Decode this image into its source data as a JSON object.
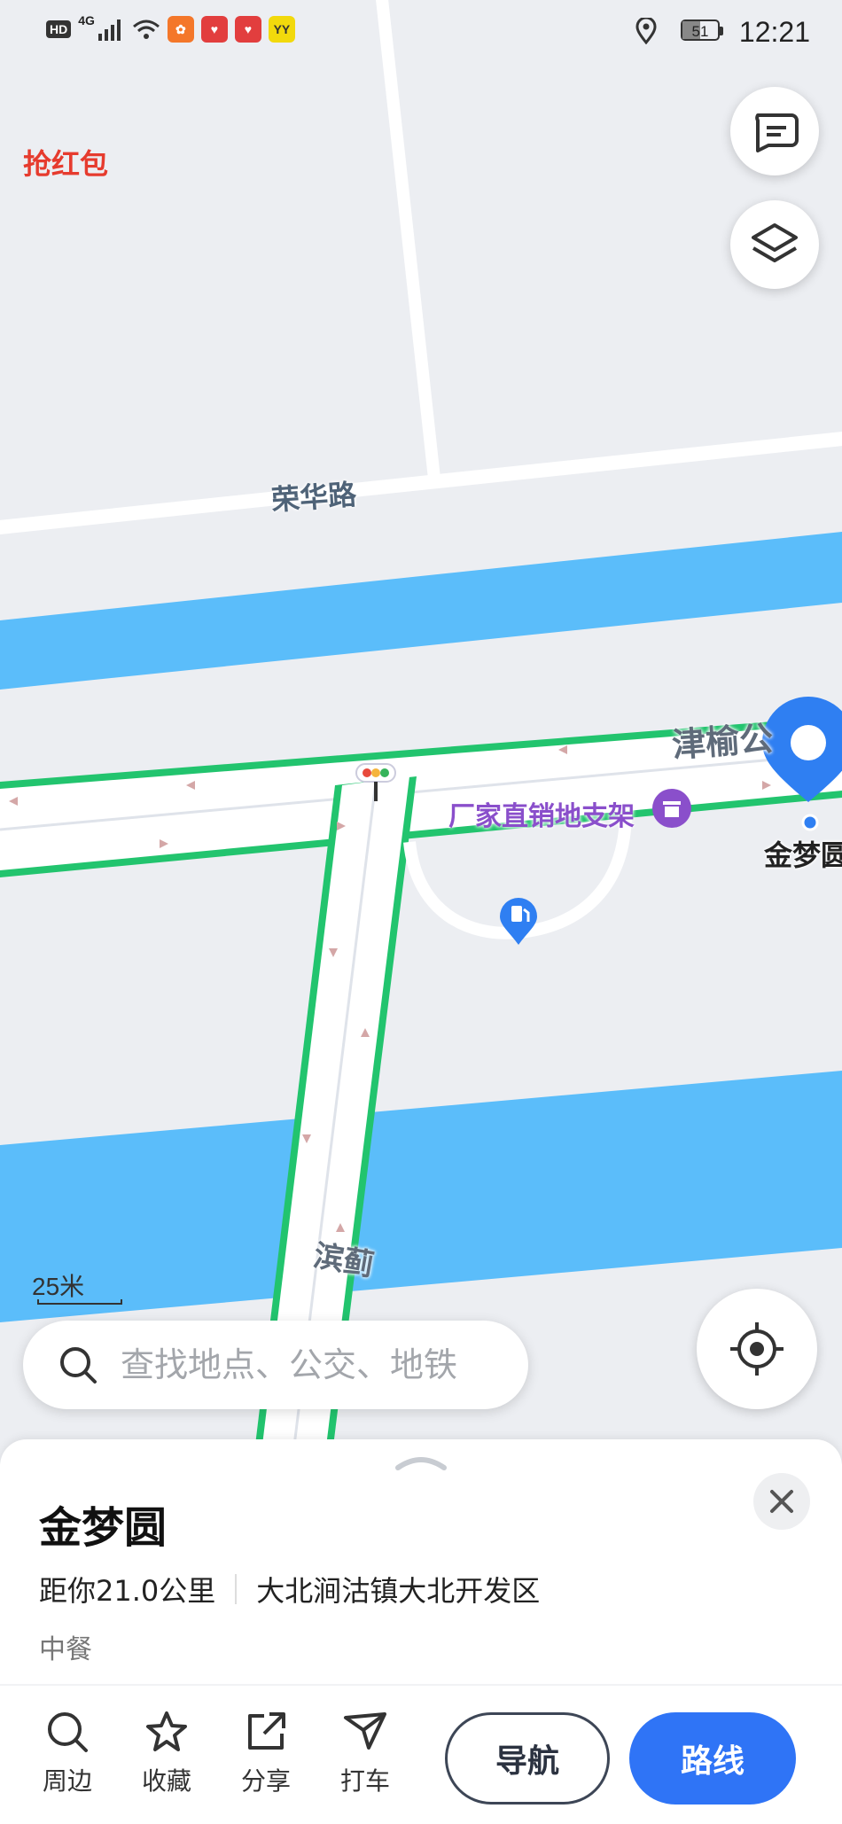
{
  "status_bar": {
    "hd": "HD",
    "network": "4G",
    "apps": [
      {
        "icon": "taobao-icon",
        "color": "#f4772a"
      },
      {
        "icon": "heart-app-icon",
        "color": "#e23e3e"
      },
      {
        "icon": "heart-app-icon",
        "color": "#e23e3e"
      },
      {
        "text": "YY",
        "color": "#f2d90c"
      }
    ],
    "battery": "51",
    "battery_level": 0.51,
    "time": "12:21"
  },
  "map": {
    "promo": "抢红包",
    "roads": {
      "ronghua": "荣华路",
      "jinyu": "津榆公",
      "bin": "滨蓟"
    },
    "poi_label": "厂家直销地支架",
    "destination_label": "金梦圆",
    "scale": "25米",
    "colors": {
      "water": "#5bbdfa",
      "road_border": "#22c46e",
      "pin": "#2f7ff2",
      "poi": "#8a4fcb"
    }
  },
  "search": {
    "placeholder": "查找地点、公交、地铁"
  },
  "sheet": {
    "title": "金梦圆",
    "distance": "距你21.0公里",
    "address": "大北涧沽镇大北开发区",
    "category": "中餐",
    "actions": {
      "nearby": "周边",
      "favorite": "收藏",
      "share": "分享",
      "taxi": "打车"
    },
    "navigate": "导航",
    "route": "路线"
  }
}
